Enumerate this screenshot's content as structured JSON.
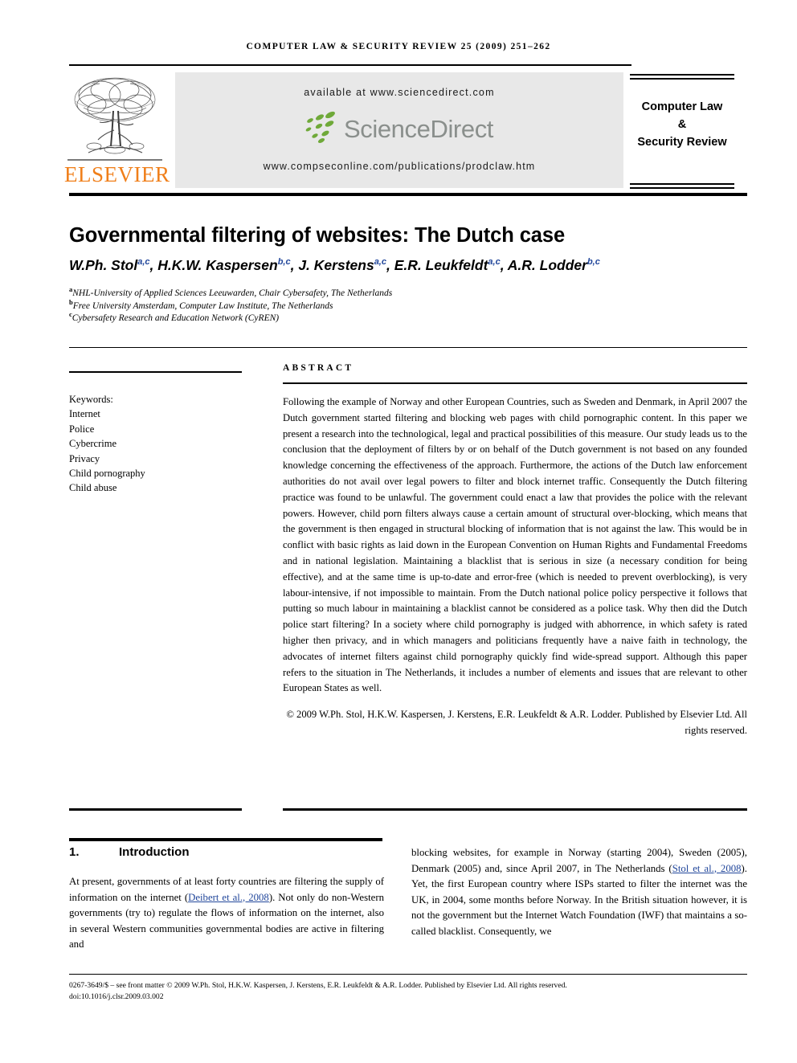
{
  "running_head": {
    "text": "computer law & security review 25 (2009) 251–262"
  },
  "masthead": {
    "publisher_wordmark": "ELSEVIER",
    "available_at": "available at www.sciencedirect.com",
    "sciencedirect_wordmark": "ScienceDirect",
    "journal_url": "www.compseconline.com/publications/prodclaw.htm",
    "journal_box_lines": [
      "Computer Law",
      "&",
      "Security Review"
    ],
    "colors": {
      "elsevier_orange": "#F07F1A",
      "sciencedirect_green": "#6FA939",
      "sciencedirect_gray": "#8a8f8c",
      "band_background": "#e8e8e8",
      "citation_blue": "#22479b"
    }
  },
  "article": {
    "title": "Governmental filtering of websites: The Dutch case",
    "authors": [
      {
        "name": "W.Ph. Stol",
        "marks": "a,c"
      },
      {
        "name": "H.K.W. Kaspersen",
        "marks": "b,c"
      },
      {
        "name": "J. Kerstens",
        "marks": "a,c"
      },
      {
        "name": "E.R. Leukfeldt",
        "marks": "a,c"
      },
      {
        "name": "A.R. Lodder",
        "marks": "b,c"
      }
    ],
    "affiliations": [
      {
        "mark": "a",
        "text": "NHL-University of Applied Sciences Leeuwarden, Chair Cybersafety, The Netherlands"
      },
      {
        "mark": "b",
        "text": "Free University Amsterdam, Computer Law Institute, The Netherlands"
      },
      {
        "mark": "c",
        "text": "Cybersafety Research and Education Network (CyREN)"
      }
    ]
  },
  "keywords": {
    "heading": "Keywords:",
    "items": [
      "Internet",
      "Police",
      "Cybercrime",
      "Privacy",
      "Child pornography",
      "Child abuse"
    ]
  },
  "abstract": {
    "heading": "ABSTRACT",
    "body": "Following the example of Norway and other European Countries, such as Sweden and Denmark, in April 2007 the Dutch government started filtering and blocking web pages with child pornographic content. In this paper we present a research into the technological, legal and practical possibilities of this measure. Our study leads us to the conclusion that the deployment of filters by or on behalf of the Dutch government is not based on any founded knowledge concerning the effectiveness of the approach. Furthermore, the actions of the Dutch law enforcement authorities do not avail over legal powers to filter and block internet traffic. Consequently the Dutch filtering practice was found to be unlawful. The government could enact a law that provides the police with the relevant powers. However, child porn filters always cause a certain amount of structural over-blocking, which means that the government is then engaged in structural blocking of information that is not against the law. This would be in conflict with basic rights as laid down in the European Convention on Human Rights and Fundamental Freedoms and in national legislation. Maintaining a blacklist that is serious in size (a necessary condition for being effective), and at the same time is up-to-date and error-free (which is needed to prevent overblocking), is very labour-intensive, if not impossible to maintain. From the Dutch national police policy perspective it follows that putting so much labour in maintaining a blacklist cannot be considered as a police task. Why then did the Dutch police start filtering? In a society where child pornography is judged with abhorrence, in which safety is rated higher then privacy, and in which managers and politicians frequently have a naive faith in technology, the advocates of internet filters against child pornography quickly find wide-spread support. Although this paper refers to the situation in The Netherlands, it includes a number of elements and issues that are relevant to other European States as well.",
    "copyright": "© 2009 W.Ph. Stol, H.K.W. Kaspersen, J. Kerstens, E.R. Leukfeldt & A.R. Lodder. Published by Elsevier Ltd. All rights reserved."
  },
  "section": {
    "number": "1.",
    "title": "Introduction",
    "left_column": {
      "part1": "At present, governments of at least forty countries are filtering the supply of information on the internet (",
      "citation1": "Deibert et al., 2008",
      "part2": "). Not only do non-Western governments (try to) regulate the flows of information on the internet, also in several Western communities governmental bodies are active in filtering and"
    },
    "right_column": {
      "part1": "blocking websites, for example in Norway (starting 2004), Sweden (2005), Denmark (2005) and, since April 2007, in The Netherlands (",
      "citation1": "Stol et al., 2008",
      "part2": "). Yet, the first European country where ISPs started to filter the internet was the UK, in 2004, some months before Norway. In the British situation however, it is not the government but the Internet Watch Foundation (IWF) that maintains a so-called blacklist. Consequently, we"
    }
  },
  "footer": {
    "front_matter": "0267-3649/$ – see front matter © 2009 W.Ph. Stol, H.K.W. Kaspersen, J. Kerstens, E.R. Leukfeldt & A.R. Lodder. Published by Elsevier Ltd. All rights reserved.",
    "doi": "doi:10.1016/j.clsr.2009.03.002"
  }
}
